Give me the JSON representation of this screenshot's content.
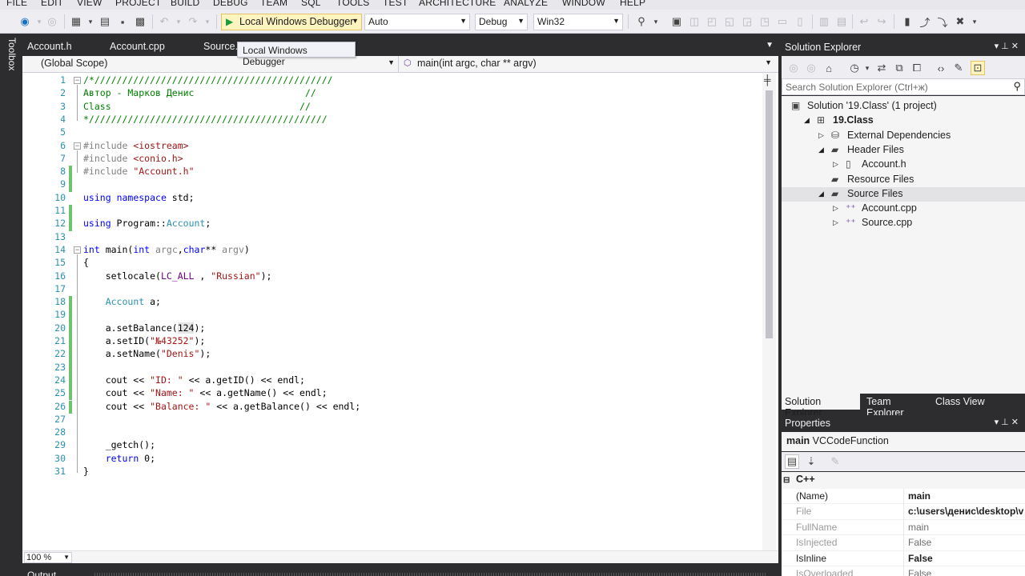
{
  "menu": [
    "FILE",
    "EDIT",
    "VIEW",
    "PROJECT",
    "BUILD",
    "DEBUG",
    "TEAM",
    "SQL",
    "TOOLS",
    "TEST",
    "ARCHITECTURE",
    "ANALYZE",
    "WINDOW",
    "HELP"
  ],
  "toolbar": {
    "debugger_label": "Local Windows Debugger",
    "config_auto": "Auto",
    "config_mode": "Debug",
    "platform": "Win32"
  },
  "tooltip": "Local Windows Debugger",
  "toolbox_label": "Toolbox",
  "editor_tabs": [
    "Account.h",
    "Account.cpp",
    "Source."
  ],
  "navbar": {
    "scope": "(Global Scope)",
    "function": "main(int argc, char ** argv)"
  },
  "zoom": "100 %",
  "output_label": "Output",
  "code_lines": [
    {
      "n": "1",
      "html": "<span class=\"cm\">/*///////////////////////////////////////////</span>"
    },
    {
      "n": "2",
      "html": "<span class=\"cm\">Автор - Марков Денис                    //</span>"
    },
    {
      "n": "3",
      "html": "<span class=\"cm\">Class                                  //</span>"
    },
    {
      "n": "4",
      "html": "<span class=\"cm\">*///////////////////////////////////////////</span>"
    },
    {
      "n": "5",
      "html": ""
    },
    {
      "n": "6",
      "html": "<span class=\"pp\">#include</span> <span class=\"str\">&lt;iostream&gt;</span>"
    },
    {
      "n": "7",
      "html": "<span class=\"pp\">#include</span> <span class=\"str\">&lt;conio.h&gt;</span>"
    },
    {
      "n": "8",
      "html": "<span class=\"pp\">#include</span> <span class=\"str\">\"Account.h\"</span>"
    },
    {
      "n": "9",
      "html": ""
    },
    {
      "n": "10",
      "html": "<span class=\"kw\">using</span> <span class=\"kw\">namespace</span> std;"
    },
    {
      "n": "11",
      "html": ""
    },
    {
      "n": "12",
      "html": "<span class=\"kw\">using</span> Program::<span class=\"ty\">Account</span>;"
    },
    {
      "n": "13",
      "html": ""
    },
    {
      "n": "14",
      "html": "<span class=\"kw\">int</span> main(<span class=\"kw\">int</span> <span class=\"pa\">argc</span>,<span class=\"kw\">char</span>** <span class=\"pa\">argv</span>)"
    },
    {
      "n": "15",
      "html": "{"
    },
    {
      "n": "16",
      "html": "    setlocale(<span class=\"mc\">LC_ALL</span> , <span class=\"str\">\"Russian\"</span>);"
    },
    {
      "n": "17",
      "html": ""
    },
    {
      "n": "18",
      "html": "    <span class=\"ty\">Account</span> a;"
    },
    {
      "n": "19",
      "html": ""
    },
    {
      "n": "20",
      "html": "    a.setBalance(<span class=\"hl\">124</span>);"
    },
    {
      "n": "21",
      "html": "    a.setID(<span class=\"str\">\"№43252\"</span>);"
    },
    {
      "n": "22",
      "html": "    a.setName(<span class=\"str\">\"Denis\"</span>);"
    },
    {
      "n": "23",
      "html": ""
    },
    {
      "n": "24",
      "html": "    cout &lt;&lt; <span class=\"str\">\"ID: \"</span> &lt;&lt; a.getID() &lt;&lt; endl;"
    },
    {
      "n": "25",
      "html": "    cout &lt;&lt; <span class=\"str\">\"Name: \"</span> &lt;&lt; a.getName() &lt;&lt; endl;"
    },
    {
      "n": "26",
      "html": "    cout &lt;&lt; <span class=\"str\">\"Balance: \"</span> &lt;&lt; a.getBalance() &lt;&lt; endl;"
    },
    {
      "n": "27",
      "html": ""
    },
    {
      "n": "28",
      "html": ""
    },
    {
      "n": "29",
      "html": "    _getch();"
    },
    {
      "n": "30",
      "html": "    <span class=\"kw\">return</span> 0;"
    },
    {
      "n": "31",
      "html": "}"
    }
  ],
  "solution_explorer": {
    "title": "Solution Explorer",
    "search_placeholder": "Search Solution Explorer (Ctrl+ж)",
    "tree": [
      {
        "label": "Solution '19.Class' (1 project)",
        "icon": "solution-icon",
        "level": 0,
        "expander": ""
      },
      {
        "label": "19.Class",
        "icon": "project-icon",
        "level": 1,
        "expander": "down",
        "bold": true
      },
      {
        "label": "External Dependencies",
        "icon": "dependencies-icon",
        "level": 2,
        "expander": "right"
      },
      {
        "label": "Header Files",
        "icon": "folder-icon",
        "level": 2,
        "expander": "down"
      },
      {
        "label": "Account.h",
        "icon": "header-file-icon",
        "level": 3,
        "expander": "right"
      },
      {
        "label": "Resource Files",
        "icon": "folder-icon",
        "level": 2,
        "expander": ""
      },
      {
        "label": "Source Files",
        "icon": "folder-icon",
        "level": 2,
        "expander": "down",
        "selected": true
      },
      {
        "label": "Account.cpp",
        "icon": "cpp-file-icon",
        "level": 3,
        "expander": "right"
      },
      {
        "label": "Source.cpp",
        "icon": "cpp-file-icon",
        "level": 3,
        "expander": "right"
      }
    ],
    "tabs": [
      "Solution Explorer",
      "Team Explorer",
      "Class View"
    ]
  },
  "properties": {
    "title": "Properties",
    "object_name": "main",
    "object_type": "VCCodeFunction",
    "category": "C++",
    "rows": [
      {
        "name": "(Name)",
        "value": "main",
        "name_bold": false,
        "value_bold": true,
        "dark": true
      },
      {
        "name": "File",
        "value": "c:\\users\\денис\\desktop\\v",
        "value_bold": true,
        "dark": false
      },
      {
        "name": "FullName",
        "value": "main",
        "dark": false
      },
      {
        "name": "IsInjected",
        "value": "False",
        "dark": false
      },
      {
        "name": "IsInline",
        "value": "False",
        "value_bold": true,
        "dark": true
      },
      {
        "name": "IsOverloaded",
        "value": "False",
        "dark": false
      }
    ]
  }
}
